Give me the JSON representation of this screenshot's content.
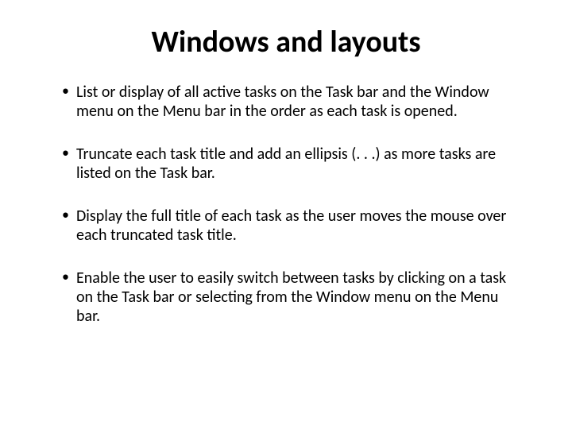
{
  "slide": {
    "title": "Windows and layouts",
    "bullets": [
      "List or display of all active tasks on the Task bar and the Window menu on the Menu bar in the order as each task is opened.",
      "Truncate each task title and add an ellipsis (. . .) as more tasks are listed on the Task  bar.",
      "Display the full title of each task as the user moves the mouse over each truncated task title.",
      "Enable the user to easily switch between tasks by clicking on a task on the Task bar or selecting from the Window menu on the Menu bar."
    ]
  }
}
